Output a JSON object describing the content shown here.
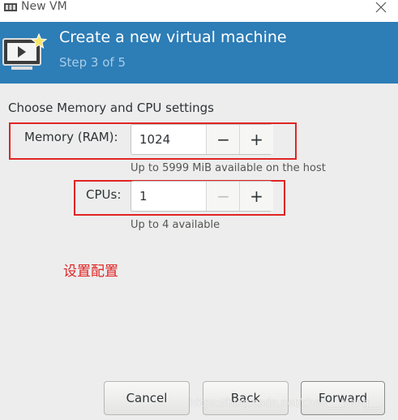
{
  "window": {
    "title": "New VM"
  },
  "header": {
    "title": "Create a new virtual machine",
    "step": "Step 3 of 5"
  },
  "section_title": "Choose Memory and CPU settings",
  "memory": {
    "label": "Memory (RAM):",
    "value": "1024",
    "decrement": "−",
    "increment": "+",
    "hint": "Up to 5999 MiB available on the host"
  },
  "cpus": {
    "label": "CPUs:",
    "value": "1",
    "decrement": "−",
    "increment": "+",
    "hint": "Up to 4 available"
  },
  "annotation": "设置配置",
  "buttons": {
    "cancel": "Cancel",
    "back": "Back",
    "forward": "Forward"
  },
  "watermark": "https://blog.csdn.net/chen___yang__",
  "colors": {
    "header_bg": "#2d7db6",
    "annotation_red": "#e02424"
  }
}
